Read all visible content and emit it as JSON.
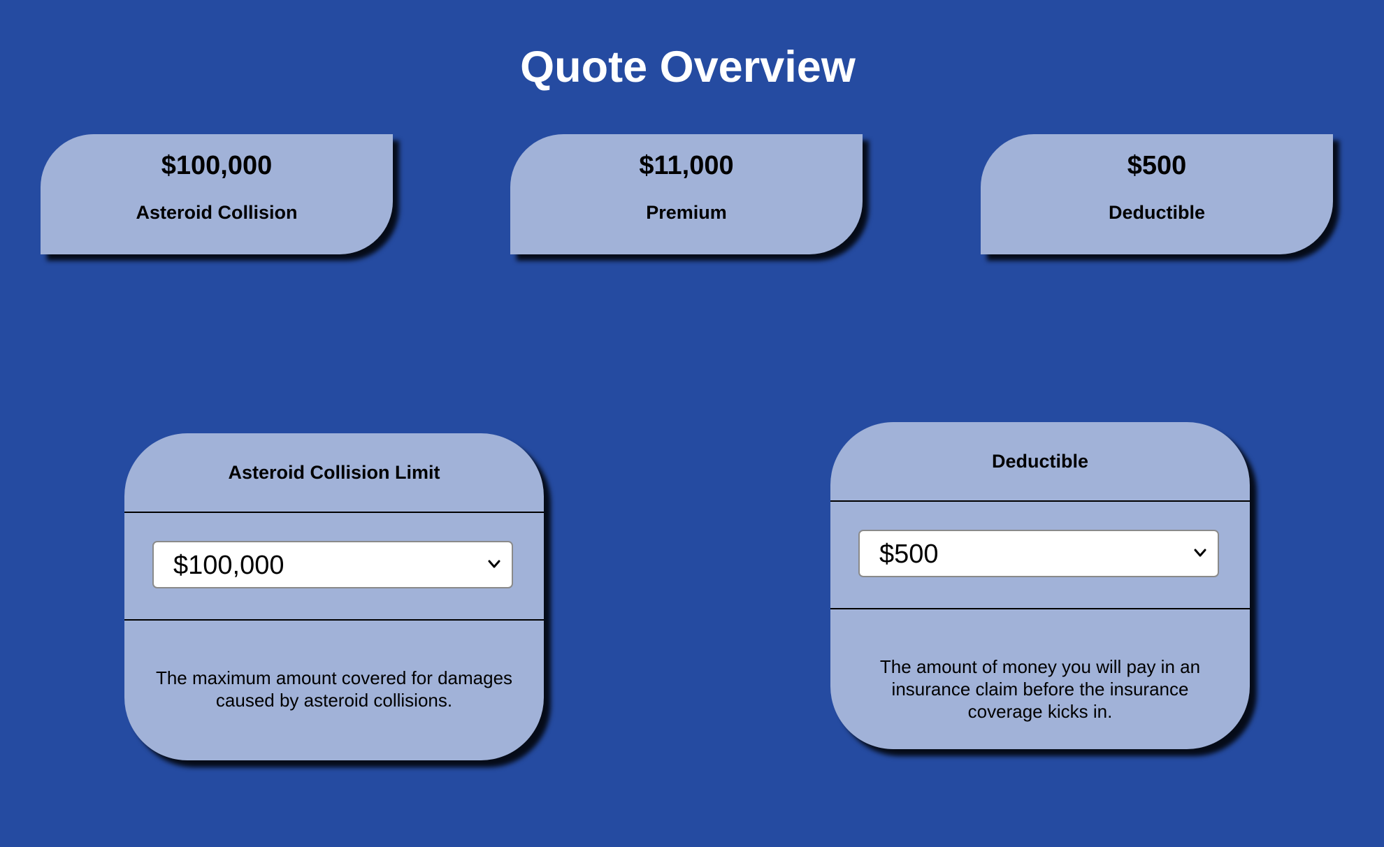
{
  "page": {
    "title": "Quote Overview"
  },
  "summary": [
    {
      "amount": "$100,000",
      "label": "Asteroid Collision"
    },
    {
      "amount": "$11,000",
      "label": "Premium"
    },
    {
      "amount": "$500",
      "label": "Deductible"
    }
  ],
  "options": {
    "collision": {
      "title": "Asteroid Collision Limit",
      "selected": "$100,000",
      "description": "The maximum amount covered for damages caused by asteroid collisions."
    },
    "deductible": {
      "title": "Deductible",
      "selected": "$500",
      "description": "The amount of money you will pay in an insurance claim before the insurance coverage kicks in."
    }
  },
  "icons": {
    "dropdown": "chevron-down-icon"
  },
  "colors": {
    "background": "#254ba1",
    "card": "#a1b2d8",
    "title_text": "#ffffff"
  }
}
